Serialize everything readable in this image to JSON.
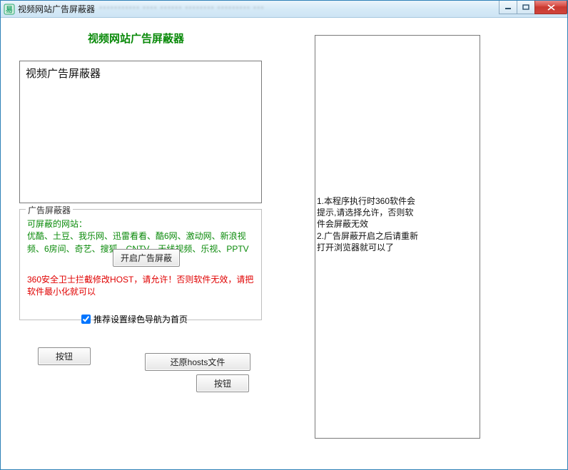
{
  "window": {
    "title": "视频网站广告屏蔽器",
    "blurred_suffix": "*********** **** ****** ******** ********* ***"
  },
  "heading": "视频网站广告屏蔽器",
  "text_panel_content": "视频广告屏蔽器",
  "groupbox": {
    "legend": "广告屏蔽器",
    "sites_label": "可屏蔽的网站：",
    "sites_list": "优酷、土豆、我乐网、迅雷看看、酷6网、激动网、新浪视频、6房间、奇艺、搜狐、CNTV、天线视频、乐视、PPTV",
    "open_button": "开启广告屏蔽",
    "warning": "360安全卫士拦截修改HOST，请允许！否则软件无效，请把软件最小化就可以",
    "checkbox_label": "推荐设置绿色导航为首页",
    "checkbox_checked": true
  },
  "buttons": {
    "a": "按钮",
    "b": "还原hosts文件",
    "c": "按钮"
  },
  "right_notice": "1.本程序执行时360软件会提示,请选择允许，否则软件会屏蔽无效\n2.广告屏蔽开启之后请重新打开浏览器就可以了"
}
